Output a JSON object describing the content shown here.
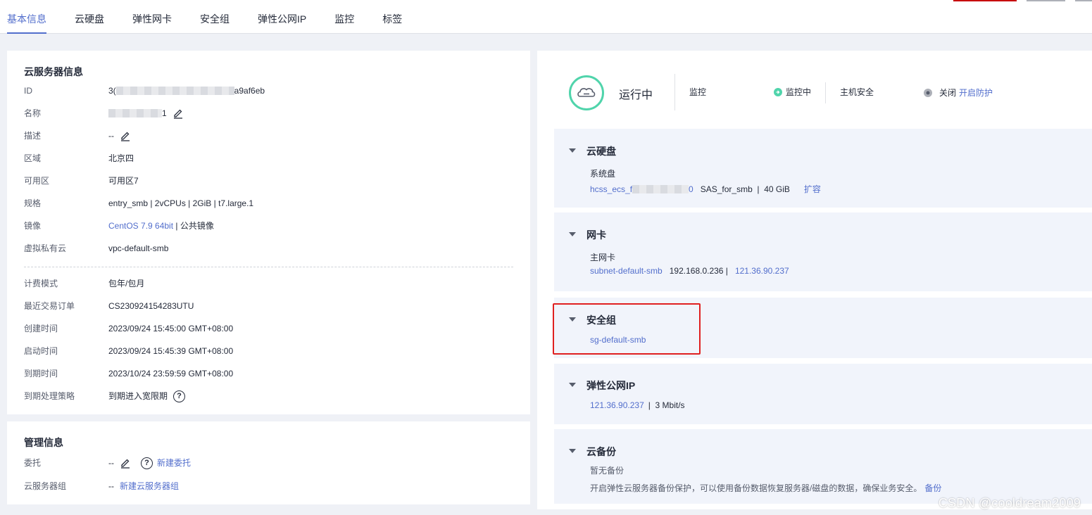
{
  "tabs": [
    "基本信息",
    "云硬盘",
    "弹性网卡",
    "安全组",
    "弹性公网IP",
    "监控",
    "标签"
  ],
  "server_info": {
    "title": "云服务器信息",
    "rows": [
      {
        "label": "ID",
        "value_prefix": "3(",
        "value_suffix": "a9af6eb"
      },
      {
        "label": "名称",
        "value_suffix": "1"
      },
      {
        "label": "描述",
        "value": "--"
      },
      {
        "label": "区域",
        "value": "北京四"
      },
      {
        "label": "可用区",
        "value": "可用区7"
      },
      {
        "label": "规格",
        "value": "entry_smb | 2vCPUs | 2GiB | t7.large.1"
      },
      {
        "label": "镜像",
        "link": "CentOS 7.9 64bit",
        "value": " | 公共镜像"
      },
      {
        "label": "虚拟私有云",
        "link": "vpc-default-smb"
      },
      {
        "label": "计费模式",
        "value": "包年/包月"
      },
      {
        "label": "最近交易订单",
        "link": "CS230924154283UTU"
      },
      {
        "label": "创建时间",
        "value": "2023/09/24 15:45:00 GMT+08:00"
      },
      {
        "label": "启动时间",
        "value": "2023/09/24 15:45:39 GMT+08:00"
      },
      {
        "label": "到期时间",
        "value": "2023/10/24 23:59:59 GMT+08:00"
      },
      {
        "label": "到期处理策略",
        "value": "到期进入宽限期"
      }
    ]
  },
  "mgmt_info": {
    "title": "管理信息",
    "rows": [
      {
        "label": "委托",
        "value": "--",
        "link": "新建委托"
      },
      {
        "label": "云服务器组",
        "value": "--",
        "link": "新建云服务器组"
      }
    ]
  },
  "status": {
    "state": "运行中",
    "monitor_label": "监控",
    "monitor_value": "监控中",
    "host_sec_label": "主机安全",
    "host_sec_value": "关闭",
    "host_sec_link": "开启防护",
    "colors": {
      "running": "#50d4ab",
      "monitor": "#50d4ab",
      "off": "#8a8e99"
    }
  },
  "sections": {
    "disk": {
      "title": "云硬盘",
      "sub": "系统盘",
      "link_prefix": "hcss_ecs_f",
      "link_suffix": "0",
      "detail": "SAS_for_smb  |  40 GiB",
      "action": "扩容"
    },
    "nic": {
      "title": "网卡",
      "sub": "主网卡",
      "link": "subnet-default-smb",
      "detail": "192.168.0.236  |",
      "ip_link": "121.36.90.237"
    },
    "sg": {
      "title": "安全组",
      "link": "sg-default-smb"
    },
    "eip": {
      "title": "弹性公网IP",
      "link": "121.36.90.237",
      "detail": "|  3 Mbit/s"
    },
    "backup": {
      "title": "云备份",
      "sub": "暂无备份",
      "desc": "开启弹性云服务器备份保护，可以使用备份数据恢复服务器/磁盘的数据，确保业务安全。",
      "action": "备份"
    }
  },
  "watermark": "CSDN @cooldream2009",
  "accent_color": "#526ecc",
  "highlight_color": "#e02020"
}
